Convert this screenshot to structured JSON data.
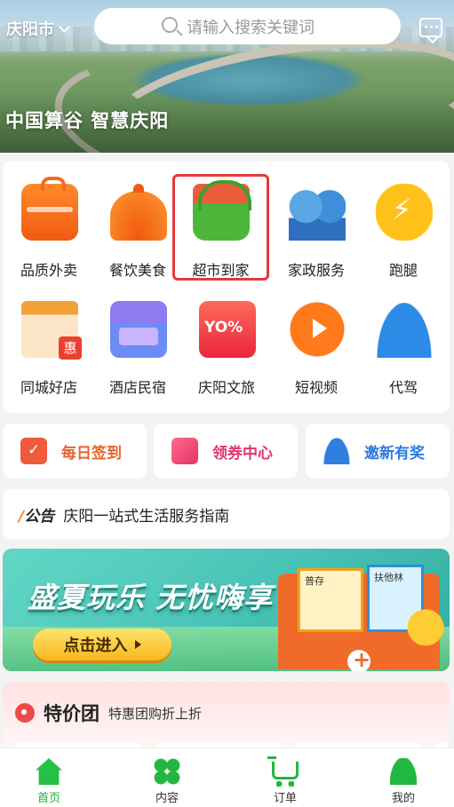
{
  "header": {
    "city": "庆阳市",
    "search_placeholder": "请输入搜索关键词",
    "slogan": "中国算谷 智慧庆阳"
  },
  "services": [
    {
      "label": "品质外卖",
      "icon": "takeout-box-icon"
    },
    {
      "label": "餐饮美食",
      "icon": "food-cloche-icon"
    },
    {
      "label": "超市到家",
      "icon": "grocery-basket-icon",
      "highlighted": true
    },
    {
      "label": "家政服务",
      "icon": "housekeeping-workers-icon"
    },
    {
      "label": "跑腿",
      "icon": "errand-runner-icon"
    },
    {
      "label": "同城好店",
      "icon": "local-shop-icon",
      "badge": "惠"
    },
    {
      "label": "酒店民宿",
      "icon": "hotel-bed-icon"
    },
    {
      "label": "庆阳文旅",
      "icon": "tourism-ticket-icon"
    },
    {
      "label": "短视频",
      "icon": "play-video-icon"
    },
    {
      "label": "代驾",
      "icon": "driver-icon"
    }
  ],
  "quick_actions": [
    {
      "label": "每日签到",
      "icon": "calendar-check-icon",
      "color": "#e8622f"
    },
    {
      "label": "领券中心",
      "icon": "coupon-icon",
      "color": "#e4346b"
    },
    {
      "label": "邀新有奖",
      "icon": "invite-user-icon",
      "color": "#2a7be0"
    }
  ],
  "notice": {
    "tag": "公告",
    "text": "庆阳一站式生活服务指南"
  },
  "promo": {
    "title": "盛夏玩乐 无忧嗨享",
    "button": "点击进入",
    "card1_label": "普存",
    "card2_label": "扶他林"
  },
  "deals": {
    "title": "特价团",
    "subtitle": "特惠团购折上折"
  },
  "tabbar": [
    {
      "label": "首页",
      "icon": "home-icon",
      "active": true
    },
    {
      "label": "内容",
      "icon": "content-grid-icon",
      "active": false
    },
    {
      "label": "订单",
      "icon": "cart-icon",
      "active": false
    },
    {
      "label": "我的",
      "icon": "profile-icon",
      "active": false
    }
  ],
  "colors": {
    "accent_green": "#1fb33f",
    "highlight_border": "#e63a3a"
  }
}
